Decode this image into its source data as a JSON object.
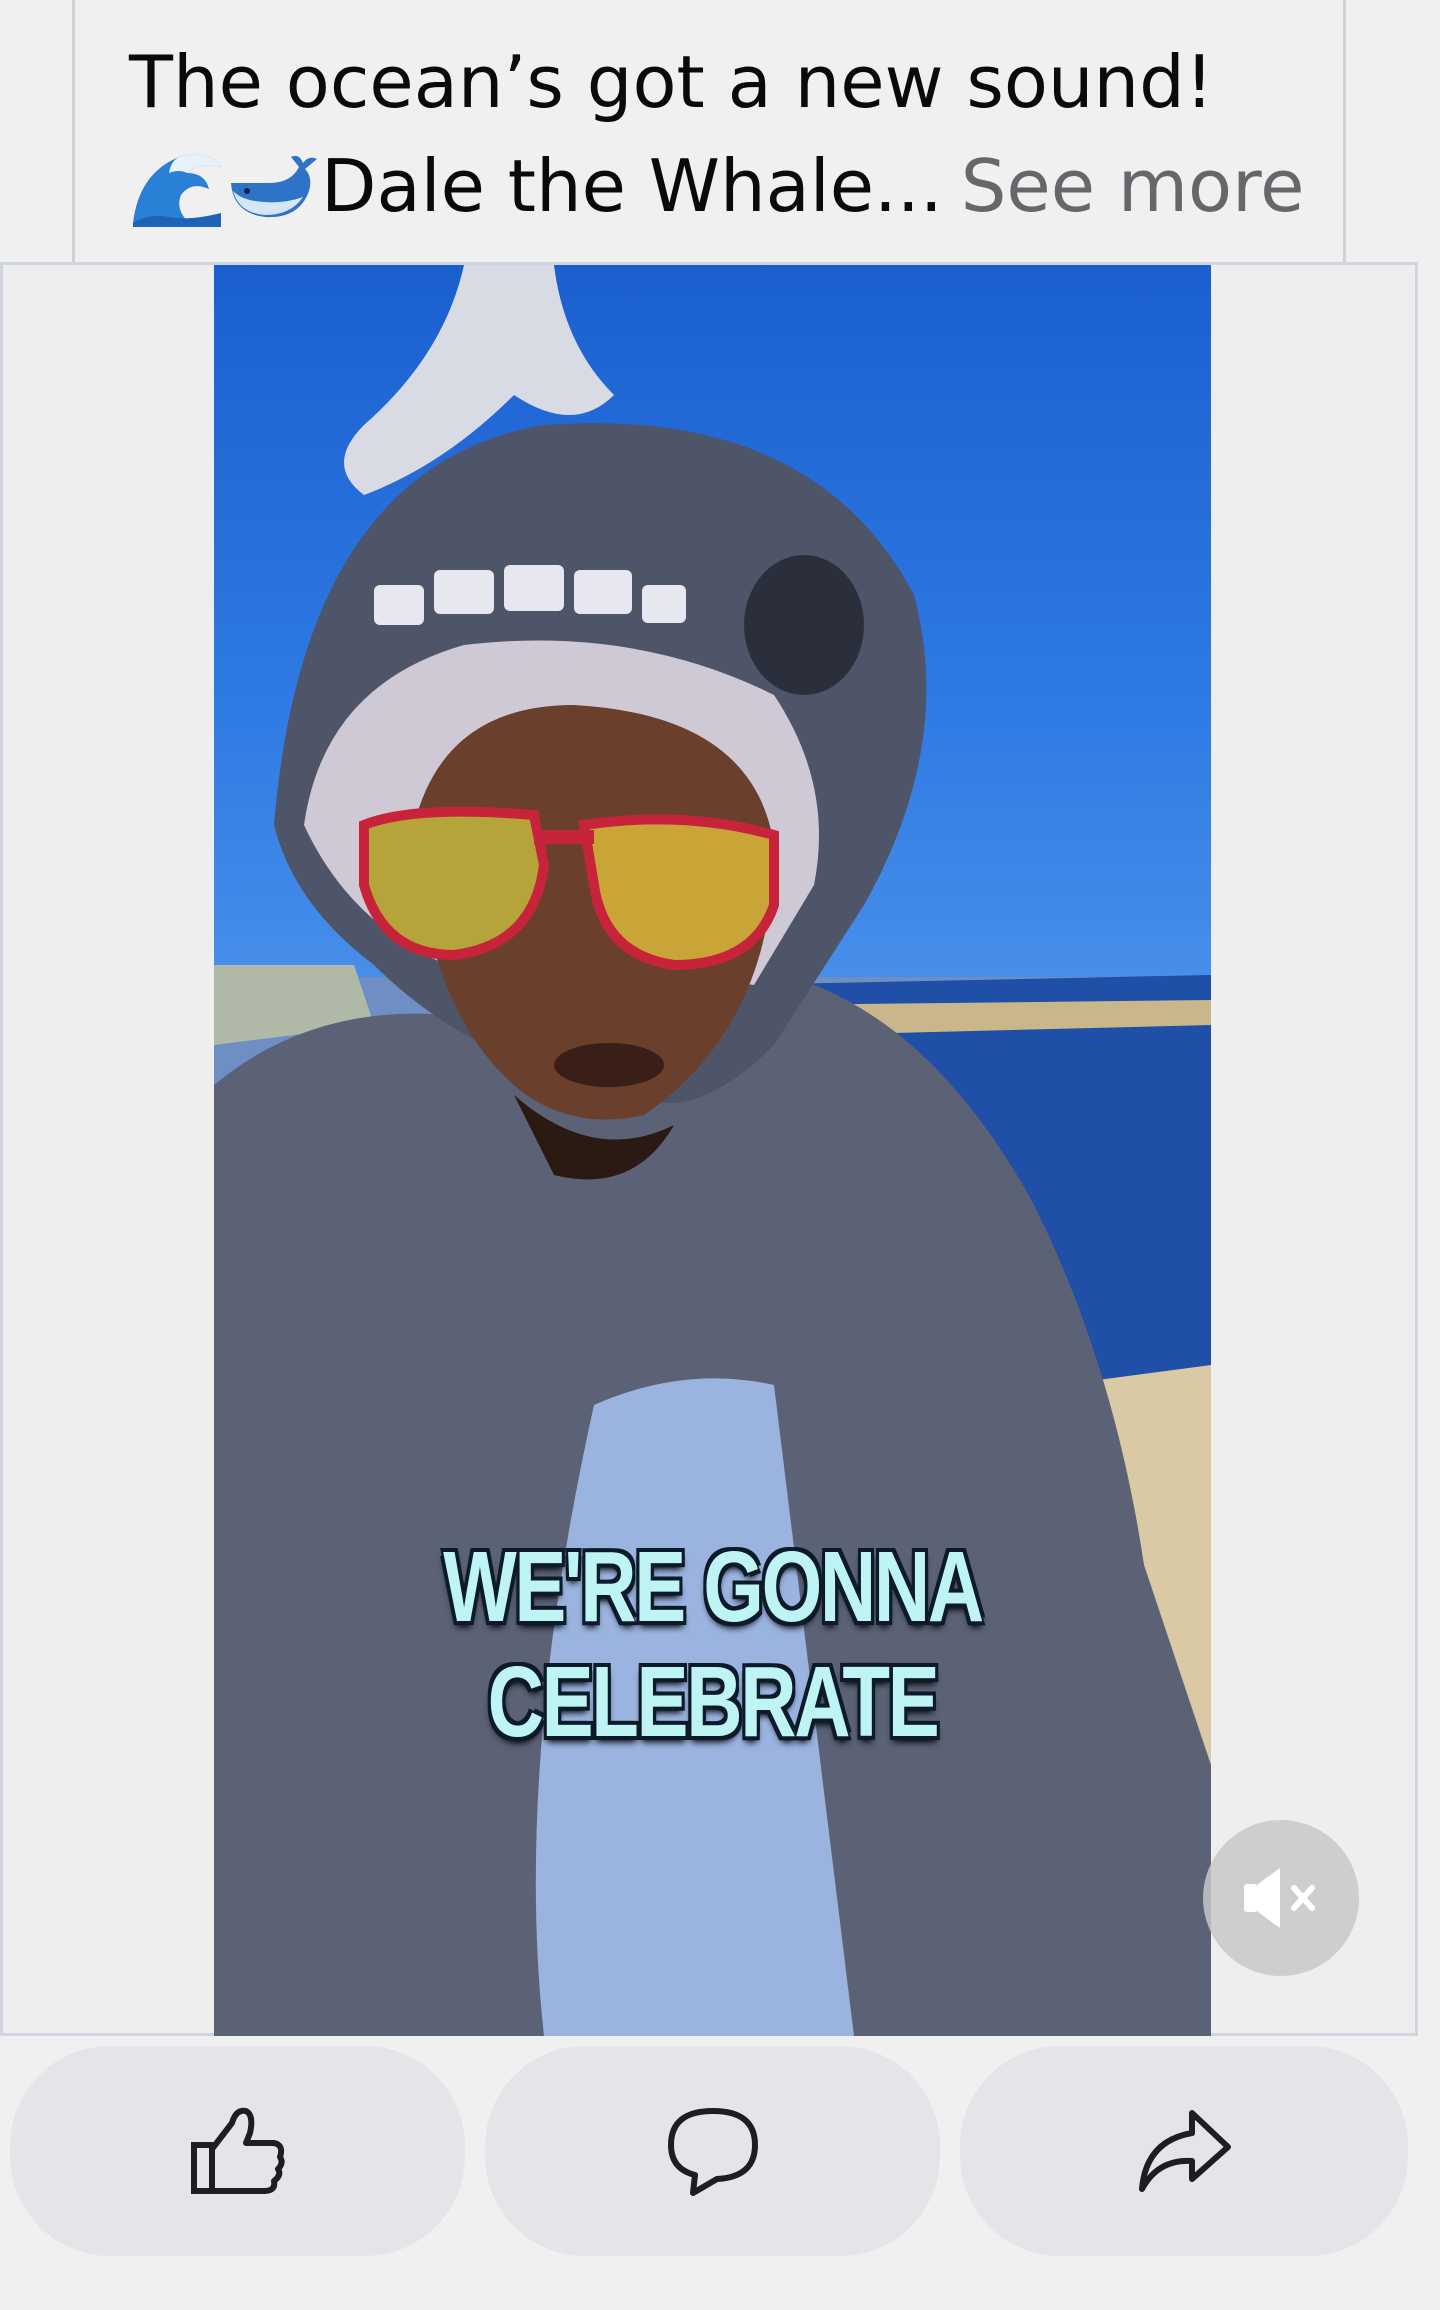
{
  "post": {
    "caption_line1": "The ocean’s got a new sound!",
    "caption_line2": "Dale the Whale...",
    "see_more": "See more",
    "emojis": [
      "water-wave-emoji",
      "whale-emoji"
    ]
  },
  "video": {
    "subtitle": "WE'RE GONNA CELEBRATE",
    "muted": true,
    "mute_icon": "speaker-muted-icon"
  },
  "actions": [
    {
      "name": "like",
      "icon": "thumbs-up-icon"
    },
    {
      "name": "comment",
      "icon": "speech-bubble-icon"
    },
    {
      "name": "share",
      "icon": "share-arrow-icon"
    }
  ],
  "colors": {
    "background": "#f0f0f0",
    "action_button_bg": "#e3e5e9",
    "see_more": "#65676b",
    "subtitle": "#bff4f4"
  }
}
